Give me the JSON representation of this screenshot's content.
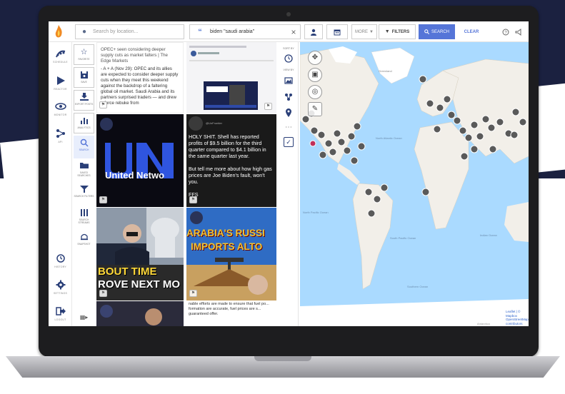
{
  "topbar": {
    "location_placeholder": "Search by location...",
    "keyword_value": "biden \"saudi arabia\"",
    "more_label": "MORE",
    "filters_label": "FILTERS",
    "search_label": "SEARCH",
    "clear_label": "CLEAR"
  },
  "leftnav": {
    "items": [
      {
        "label": "SCHEDULE"
      },
      {
        "label": "REACTOR"
      },
      {
        "label": "MONITOR"
      },
      {
        "label": "API"
      }
    ],
    "bottom": [
      {
        "label": "HISTORY"
      },
      {
        "label": "SETTINGS"
      },
      {
        "label": "LOGOUT"
      }
    ]
  },
  "subnav": {
    "items": [
      {
        "label": "FAVORITE"
      },
      {
        "label": "SAVE"
      },
      {
        "label": "EXPORT POSTS"
      },
      {
        "label": "ANALYTICS"
      },
      {
        "label": "SEARCH"
      },
      {
        "label": "SAVED SEARCHES"
      },
      {
        "label": "SEARCH FILTERS"
      },
      {
        "label": "SEARCH STREAMS"
      },
      {
        "label": "SNAPSHOT"
      }
    ]
  },
  "feed": {
    "post1_title": "OPEC+ seen considering deeper supply cuts as market falters | The Edge Markets",
    "post1_body": "- A + A (Nov 29): OPEC and its allies are expected to consider deeper supply cuts when they meet this weekend against the backdrop of a faltering global oil market. Saudi Arabia and its partners surprised traders — and drew a force rebuke from",
    "post3_text": "United Netwo",
    "post4_text": "HOLY SHIT. Shell has reported profits of $9.5 billion for the third quarter compared to $4.1 billion in the same quarter last year.\n\nBut tell me more about how high gas prices are Joe Biden's fault, won't you.\n\nFFS",
    "post5_line1": "BOUT TIME",
    "post5_line2": "ROVE NEXT MO",
    "post6_line1": "ARABIA'S RUSSI",
    "post6_line2": "IMPORTS ALTO",
    "post8_text": "nable efforts are made to ensure that fuel po... formation are accurate, fuel prices are s... guaranteed offer."
  },
  "rail": {
    "sort_label": "SORT BY",
    "view_label": "VIEW BY"
  },
  "map": {
    "labels": {
      "greenland": "Greenland",
      "north_atlantic": "North Atlantic Ocean",
      "north_pacific": "North Pacific Ocean",
      "south_pacific": "South Pacific Ocean",
      "south_atlantic": "South Atlantic Ocean",
      "indian": "Indian Ocean",
      "southern": "Southern Ocean",
      "antarctica": "Antarctica"
    },
    "attribution": "Leaflet | © Mapbox OpenStreetMap contributors"
  }
}
